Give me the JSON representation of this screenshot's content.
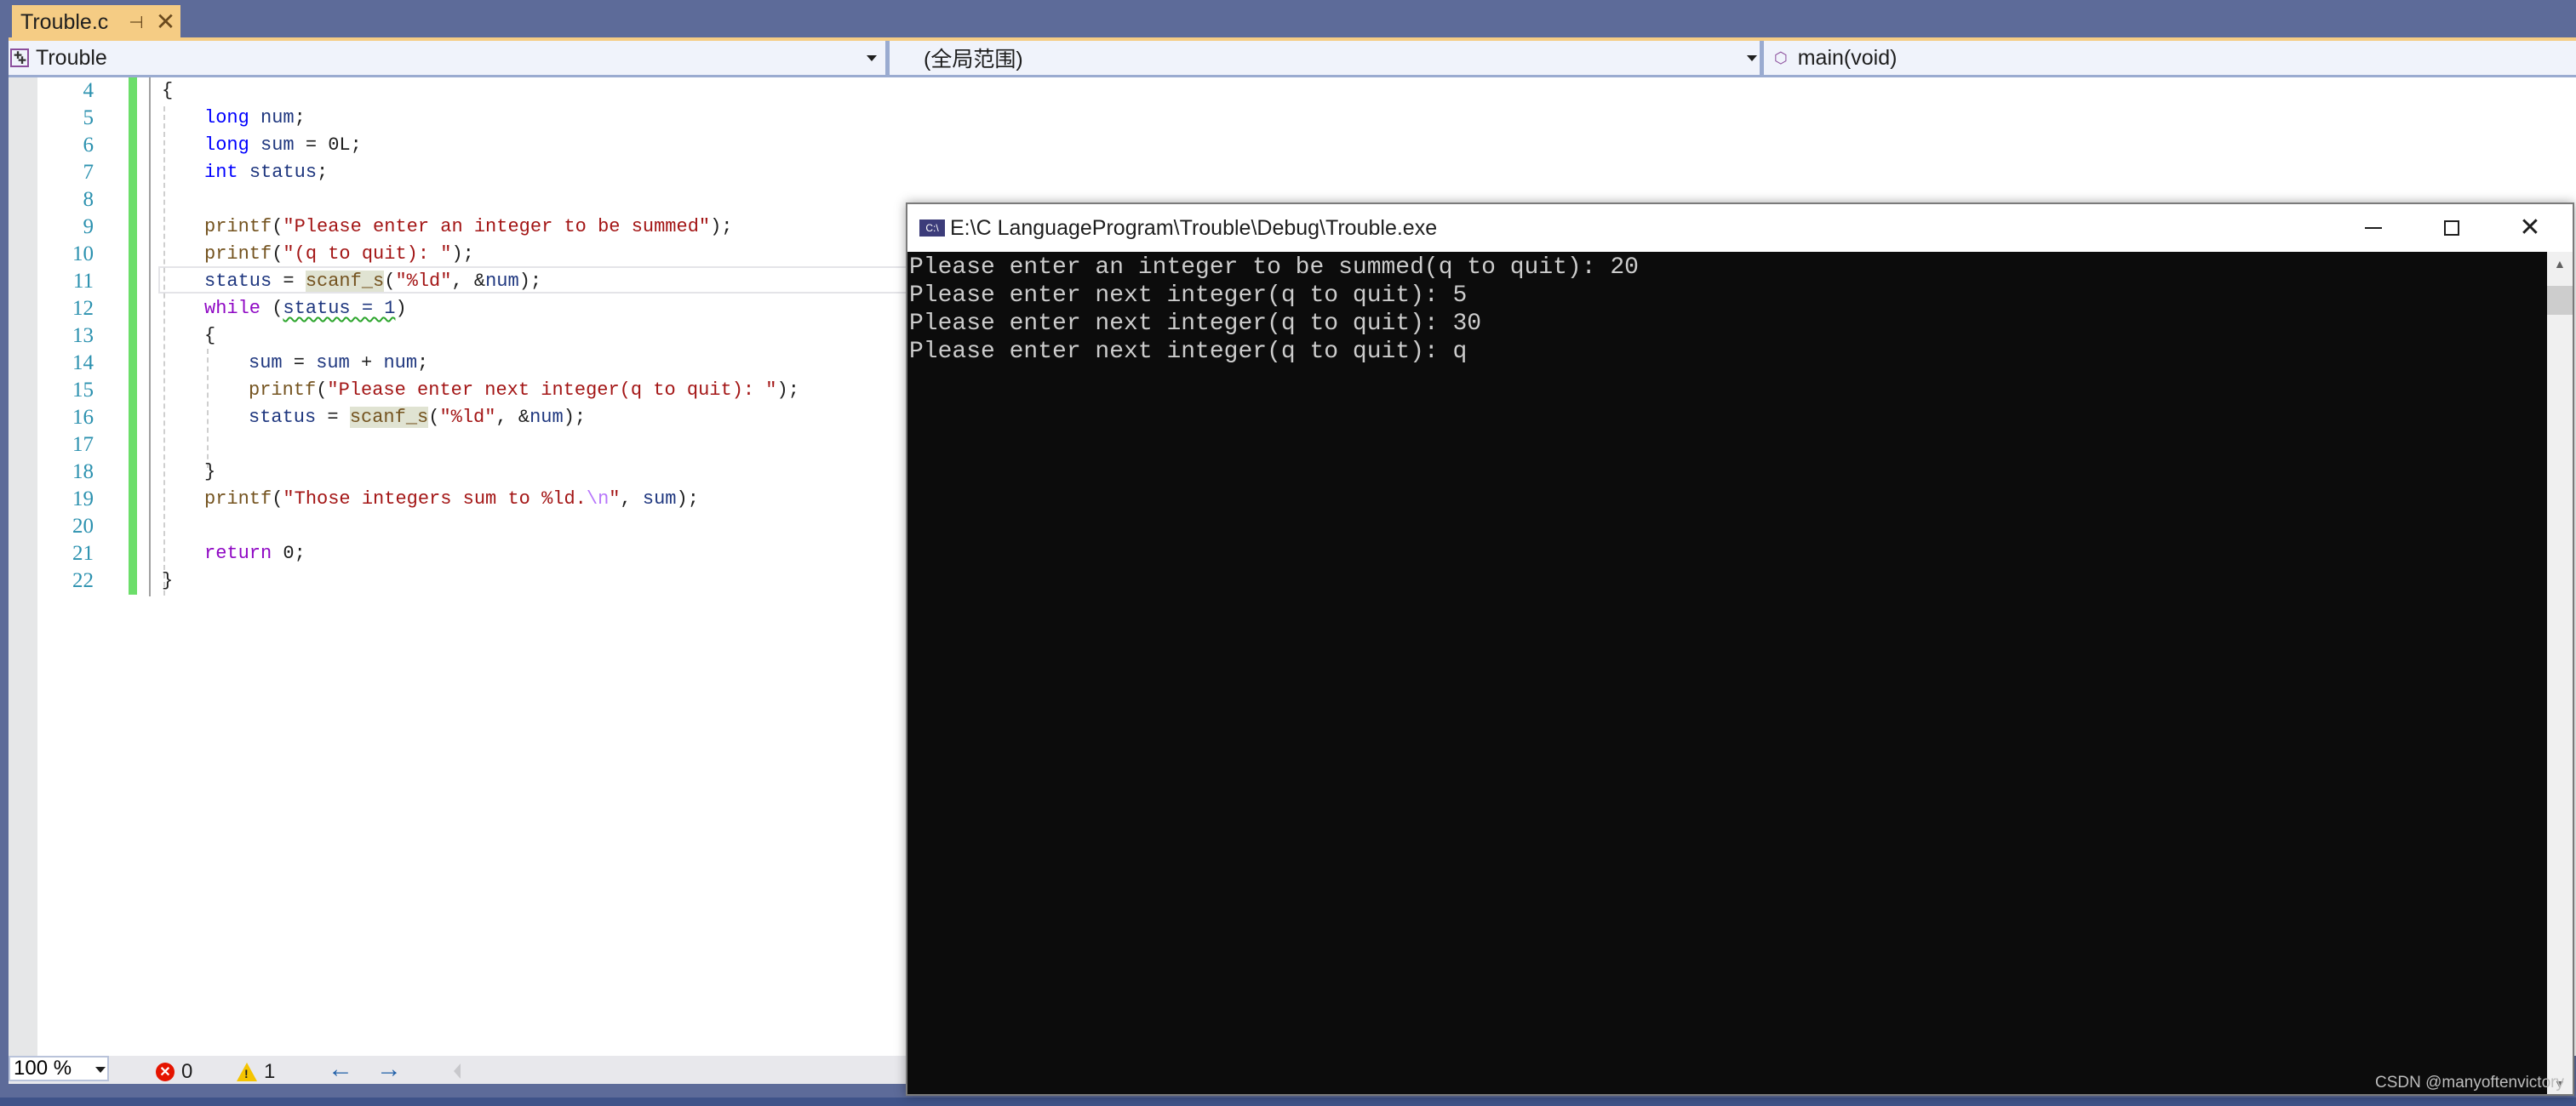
{
  "tabs": [
    {
      "label": "Trouble.c",
      "pin_icon": "pin-icon",
      "close_icon": "close-icon",
      "active": true
    }
  ],
  "navbar": {
    "project": "Trouble",
    "scope": "(全局范围)",
    "member": "main(void)"
  },
  "editor": {
    "lines": [
      {
        "num": "4"
      },
      {
        "num": "5"
      },
      {
        "num": "6"
      },
      {
        "num": "7"
      },
      {
        "num": "8"
      },
      {
        "num": "9"
      },
      {
        "num": "10"
      },
      {
        "num": "11"
      },
      {
        "num": "12"
      },
      {
        "num": "13"
      },
      {
        "num": "14"
      },
      {
        "num": "15"
      },
      {
        "num": "16"
      },
      {
        "num": "17"
      },
      {
        "num": "18"
      },
      {
        "num": "19"
      },
      {
        "num": "20"
      },
      {
        "num": "21"
      },
      {
        "num": "22"
      }
    ],
    "tokens": {
      "l4_brace": "{",
      "l5_kw": "long",
      "l5_var": "num",
      "l5_end": ";",
      "l6_kw": "long",
      "l6_var": "sum",
      "l6_rest": " = 0L;",
      "l7_kw": "int",
      "l7_var": "status",
      "l7_end": ";",
      "l9_fn": "printf",
      "l9_open": "(",
      "l9_str": "\"Please enter an integer to be summed\"",
      "l9_end": ");",
      "l10_fn": "printf",
      "l10_open": "(",
      "l10_str": "\"(q to quit): \"",
      "l10_end": ");",
      "l11_var": "status",
      "l11_eq": " = ",
      "l11_fn": "scanf_s",
      "l11_open": "(",
      "l11_str": "\"%ld\"",
      "l11_mid": ", &",
      "l11_var2": "num",
      "l11_end": ");",
      "l12_kw": "while",
      "l12_open": " (",
      "l12_cond": "status = 1",
      "l12_close": ")",
      "l13_brace": "{",
      "l14_var1": "sum",
      "l14_eq": " = ",
      "l14_var2": "sum",
      "l14_plus": " + ",
      "l14_var3": "num",
      "l14_end": ";",
      "l15_fn": "printf",
      "l15_open": "(",
      "l15_str": "\"Please enter next integer(q to quit): \"",
      "l15_end": ");",
      "l16_var": "status",
      "l16_eq": " = ",
      "l16_fn": "scanf_s",
      "l16_open": "(",
      "l16_str": "\"%ld\"",
      "l16_mid": ", &",
      "l16_var2": "num",
      "l16_end": ");",
      "l18_brace": "}",
      "l19_fn": "printf",
      "l19_open": "(",
      "l19_str": "\"Those integers sum to %ld.",
      "l19_esc": "\\n",
      "l19_strend": "\"",
      "l19_mid": ", ",
      "l19_var": "sum",
      "l19_end": ");",
      "l21_kw": "return",
      "l21_rest": " 0;",
      "l22_brace": "}"
    }
  },
  "statusbar": {
    "zoom": "100 %",
    "errors": "0",
    "warnings": "1"
  },
  "console": {
    "title": "E:\\C LanguageProgram\\Trouble\\Debug\\Trouble.exe",
    "icon_label": "C:\\",
    "output": [
      "Please enter an integer to be summed(q to quit): 20",
      "Please enter next integer(q to quit): 5",
      "Please enter next integer(q to quit): 30",
      "Please enter next integer(q to quit): q"
    ]
  },
  "watermark": "CSDN @manyoftenvictory",
  "colors": {
    "tab_active": "#F5CC84",
    "chrome": "#5D6B99",
    "line_number": "#2B91AF",
    "keyword": "#0000FF",
    "control_keyword": "#8F08C4",
    "string": "#A31515",
    "function": "#74531F",
    "variable": "#1F377F",
    "changed_bar": "#6CDE6A",
    "console_bg": "#0C0C0C",
    "console_text": "#CCCCCC"
  }
}
